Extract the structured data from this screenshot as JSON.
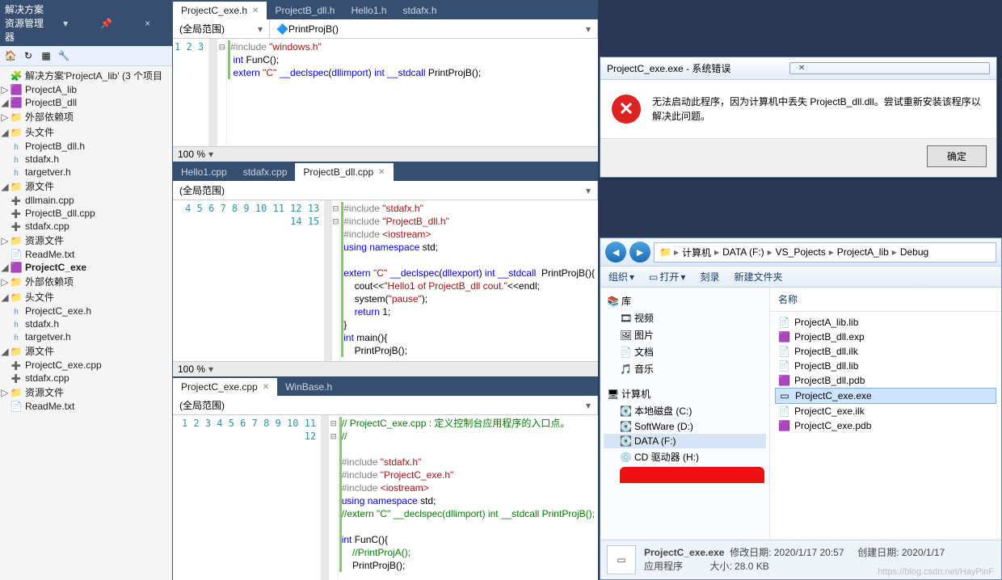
{
  "solution_explorer": {
    "title": "解决方案资源管理器",
    "solution_label": "解决方案'ProjectA_lib' (3 个项目",
    "projects": [
      {
        "name": "ProjectA_lib"
      },
      {
        "name": "ProjectB_dll",
        "expanded": true,
        "folders": [
          {
            "name": "外部依赖项",
            "items": []
          },
          {
            "name": "头文件",
            "items": [
              "ProjectB_dll.h",
              "stdafx.h",
              "targetver.h"
            ]
          },
          {
            "name": "源文件",
            "items": [
              "dllmain.cpp",
              "ProjectB_dll.cpp",
              "stdafx.cpp"
            ]
          },
          {
            "name": "资源文件",
            "items": []
          }
        ],
        "files": [
          "ReadMe.txt"
        ]
      },
      {
        "name": "ProjectC_exe",
        "expanded": true,
        "bold": true,
        "folders": [
          {
            "name": "外部依赖项",
            "items": []
          },
          {
            "name": "头文件",
            "items": [
              "ProjectC_exe.h",
              "stdafx.h",
              "targetver.h"
            ]
          },
          {
            "name": "源文件",
            "items": [
              "ProjectC_exe.cpp",
              "stdafx.cpp"
            ]
          },
          {
            "name": "资源文件",
            "items": []
          }
        ],
        "files": [
          "ReadMe.txt"
        ]
      }
    ]
  },
  "pane1": {
    "tabs": [
      {
        "label": "ProjectC_exe.h",
        "active": true
      },
      {
        "label": "ProjectB_dll.h"
      },
      {
        "label": "Hello1.h"
      },
      {
        "label": "stdafx.h"
      }
    ],
    "scope_left": "(全局范围)",
    "scope_right": "PrintProjB()",
    "zoom": "100 %",
    "lines": [
      {
        "n": "1",
        "html": "<span class='pp'>#include</span> <span class='str'>\"windows.h\"</span>",
        "out": "⊟"
      },
      {
        "n": "2",
        "html": " <span class='kw'>int</span> FunC();"
      },
      {
        "n": "3",
        "html": " <span class='kw'>extern</span> <span class='str'>\"C\"</span> <span class='kw'>__declspec</span>(<span class='kw'>dllimport</span>) <span class='kw'>int</span> <span class='kw'>__stdcall</span> PrintProjB();"
      }
    ]
  },
  "pane2": {
    "tabs": [
      {
        "label": "Hello1.cpp"
      },
      {
        "label": "stdafx.cpp"
      },
      {
        "label": "ProjectB_dll.cpp",
        "active": true
      }
    ],
    "scope_left": "(全局范围)",
    "zoom": "100 %",
    "lines": [
      {
        "n": "4",
        "html": "<span class='pp'>#include</span> <span class='str'>\"stdafx.h\"</span>"
      },
      {
        "n": "5",
        "html": "<span class='pp'>#include</span> <span class='str'>\"ProjectB_dll.h\"</span>"
      },
      {
        "n": "6",
        "html": "<span class='pp'>#include</span> <span class='str'>&lt;iostream&gt;</span>"
      },
      {
        "n": "7",
        "html": "<span class='kw'>using</span> <span class='kw'>namespace</span> std;"
      },
      {
        "n": "8",
        "html": ""
      },
      {
        "n": "9",
        "html": "<span class='kw'>extern</span> <span class='str'>\"C\"</span> <span class='kw'>__declspec</span>(<span class='kw'>dllexport</span>) <span class='kw'>int</span> <span class='kw'>__stdcall</span>  PrintProjB(){",
        "out": "⊟"
      },
      {
        "n": "10",
        "html": "    cout&lt;&lt;<span class='str'>\"Hello1 of ProjectB_dll cout.\"</span>&lt;&lt;endl;"
      },
      {
        "n": "11",
        "html": "    system(<span class='str'>\"pause\"</span>);"
      },
      {
        "n": "12",
        "html": "    <span class='kw'>return</span> 1;"
      },
      {
        "n": "13",
        "html": "}"
      },
      {
        "n": "14",
        "html": "<span class='kw'>int</span> main(){",
        "out": "⊟"
      },
      {
        "n": "15",
        "html": "    PrintProjB();"
      }
    ]
  },
  "pane3": {
    "tabs": [
      {
        "label": "ProjectC_exe.cpp",
        "active": true
      },
      {
        "label": "WinBase.h"
      }
    ],
    "scope_left": "(全局范围)",
    "lines": [
      {
        "n": "1",
        "html": "<span class='cm'>// ProjectC_exe.cpp : 定义控制台应用程序的入口点。</span>",
        "out": "⊟"
      },
      {
        "n": "2",
        "html": "<span class='cm'>//</span>"
      },
      {
        "n": "3",
        "html": ""
      },
      {
        "n": "4",
        "html": "<span class='pp'>#include</span> <span class='str'>\"stdafx.h\"</span>"
      },
      {
        "n": "5",
        "html": "<span class='pp'>#include</span> <span class='str'>\"ProjectC_exe.h\"</span>"
      },
      {
        "n": "6",
        "html": "<span class='pp'>#include</span> <span class='str'>&lt;iostream&gt;</span>"
      },
      {
        "n": "7",
        "html": "<span class='kw'>using</span> <span class='kw'>namespace</span> std;"
      },
      {
        "n": "8",
        "html": "<span class='cm'>//extern \"C\" __declspec(dllimport) int __stdcall PrintProjB();</span>"
      },
      {
        "n": "9",
        "html": ""
      },
      {
        "n": "10",
        "html": "<span class='kw'>int</span> FunC(){",
        "out": "⊟"
      },
      {
        "n": "11",
        "html": "    <span class='cm'>//PrintProjA();</span>"
      },
      {
        "n": "12",
        "html": "    PrintProjB();"
      }
    ]
  },
  "dialog": {
    "title": "ProjectC_exe.exe - 系统错误",
    "message": "无法启动此程序，因为计算机中丢失 ProjectB_dll.dll。尝试重新安装该程序以解决此问题。",
    "ok": "确定"
  },
  "explorer": {
    "crumbs": [
      "计算机",
      "DATA (F:)",
      "VS_Pojects",
      "ProjectA_lib",
      "Debug"
    ],
    "toolbar": {
      "org": "组织",
      "open": "打开",
      "burn": "刻录",
      "newf": "新建文件夹"
    },
    "tree": [
      {
        "label": "库",
        "icon": "📚"
      },
      {
        "label": "视频",
        "icon": "🎞",
        "indent": 1
      },
      {
        "label": "图片",
        "icon": "🖼",
        "indent": 1
      },
      {
        "label": "文档",
        "icon": "📄",
        "indent": 1
      },
      {
        "label": "音乐",
        "icon": "🎵",
        "indent": 1
      },
      {
        "label": "",
        "spacer": true
      },
      {
        "label": "计算机",
        "icon": "🖥"
      },
      {
        "label": "本地磁盘 (C:)",
        "icon": "💽",
        "indent": 1
      },
      {
        "label": "SoftWare (D:)",
        "icon": "💽",
        "indent": 1
      },
      {
        "label": "DATA (F:)",
        "icon": "💽",
        "indent": 1,
        "sel": true
      },
      {
        "label": "CD 驱动器 (H:)",
        "icon": "💿",
        "indent": 1
      }
    ],
    "header": "名称",
    "files": [
      {
        "name": "ProjectA_lib.lib",
        "icon": "📄"
      },
      {
        "name": "ProjectB_dll.exp",
        "icon": "🟪"
      },
      {
        "name": "ProjectB_dll.ilk",
        "icon": "📄"
      },
      {
        "name": "ProjectB_dll.lib",
        "icon": "📄"
      },
      {
        "name": "ProjectB_dll.pdb",
        "icon": "🟪"
      },
      {
        "name": "ProjectC_exe.exe",
        "icon": "▭",
        "sel": true
      },
      {
        "name": "ProjectC_exe.ilk",
        "icon": "📄"
      },
      {
        "name": "ProjectC_exe.pdb",
        "icon": "🟪"
      }
    ],
    "status": {
      "name": "ProjectC_exe.exe",
      "type": "应用程序",
      "mod_label": "修改日期:",
      "mod": "2020/1/17 20:57",
      "size_label": "大小:",
      "size": "28.0 KB",
      "create_label": "创建日期:",
      "create": "2020/1/17"
    }
  },
  "watermark": "https://blog.csdn.net/HayPinF"
}
